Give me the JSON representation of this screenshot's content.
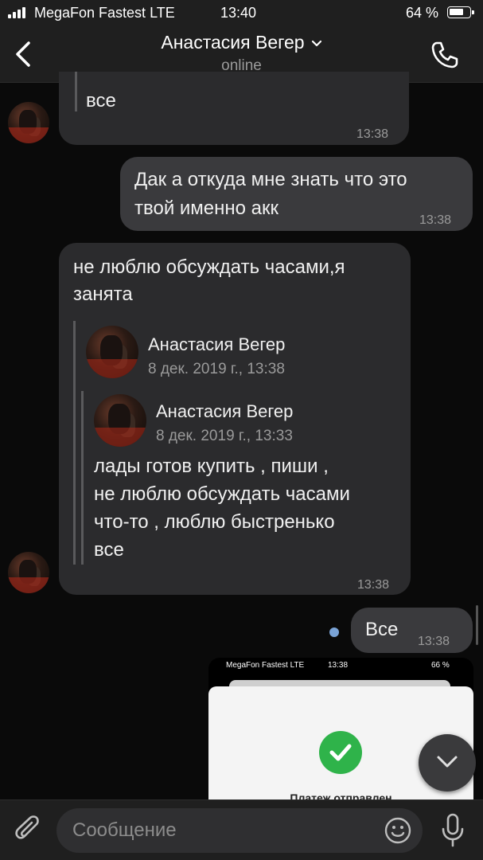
{
  "status_bar": {
    "carrier": "MegaFon Fastest LTE",
    "time": "13:40",
    "battery": "64 %"
  },
  "header": {
    "contact_name": "Анастасия Вегер",
    "status": "online"
  },
  "messages": [
    {
      "direction": "in",
      "text": "все",
      "time": "13:38"
    },
    {
      "direction": "out",
      "text_lines": [
        "Дак а откуда мне знать что это",
        "твой именно акк"
      ],
      "time": "13:38"
    },
    {
      "direction": "in",
      "text_lines": [
        "не люблю обсуждать часами,я",
        "занята"
      ],
      "time": "13:38",
      "forwarded": {
        "name": "Анастасия Вегер",
        "date": "8 дек. 2019 г., 13:38",
        "nested": {
          "name": "Анастасия Вегер",
          "date": "8 дек. 2019 г., 13:33",
          "text_lines": [
            "лады готов купить , пиши ,",
            "не люблю обсуждать часами",
            "что-то , люблю быстренько",
            "все"
          ]
        }
      }
    },
    {
      "direction": "out",
      "text": "Все",
      "time": "13:38",
      "unread": true
    },
    {
      "direction": "out",
      "type": "image",
      "image_content": {
        "carrier": "MegaFon Fastest LTE",
        "time": "13:38",
        "battery": "66 %",
        "caption": "Платеж отправлен"
      }
    }
  ],
  "composer": {
    "placeholder": "Сообщение"
  },
  "icons": {
    "back": "chevron-left-icon",
    "dropdown": "chevron-down-icon",
    "call": "phone-icon",
    "attach": "paperclip-icon",
    "emoji": "smiley-icon",
    "mic": "microphone-icon",
    "scroll_down": "chevron-down-icon"
  },
  "colors": {
    "background": "#0a0a0a",
    "incoming_bubble": "#2b2b2d",
    "outgoing_bubble": "#3a3a3d",
    "unread_dot": "#7aa3d6",
    "success_check": "#2fb34a"
  }
}
